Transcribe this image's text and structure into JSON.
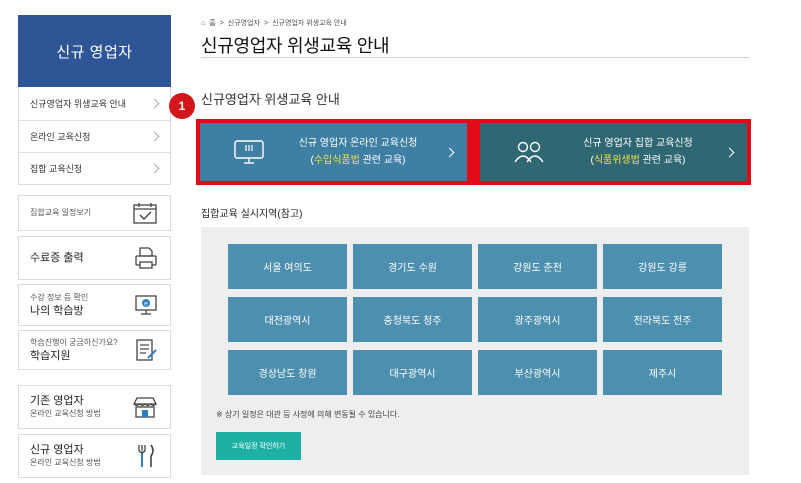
{
  "sidebar": {
    "title": "신규 영업자",
    "menu": [
      {
        "label": "신규영업자 위생교육 안내"
      },
      {
        "label": "온라인 교육신청"
      },
      {
        "label": "집합 교육신청"
      }
    ],
    "boxes": [
      {
        "small": "집합교육 일정보기",
        "big": "",
        "icon": "calendar-check-icon"
      },
      {
        "small": "",
        "big": "수료증 출력",
        "icon": "printer-icon"
      },
      {
        "small": "수강 정보 등 확인",
        "big": "나의 학습방",
        "icon": "monitor-e-icon"
      },
      {
        "small": "학습진행이 궁금하신가요?",
        "big": "학습지원",
        "icon": "document-pen-icon"
      },
      {
        "small": "온라인 교육신청 방법",
        "big": "기존 영업자",
        "icon": "store-icon"
      },
      {
        "small": "온라인 교육신청 방법",
        "big": "신규 영업자",
        "icon": "fork-knife-icon"
      }
    ]
  },
  "breadcrumb": {
    "home_label": "홈",
    "items": [
      "신규영업자",
      "신규영업자 위생교육 안내"
    ]
  },
  "page_title": "신규영업자 위생교육 안내",
  "section_title": "신규영업자 위생교육 안내",
  "step_badge": "1",
  "cta": {
    "online": {
      "line1": "신규 영업자 온라인 교육신청",
      "highlight": "수입식품법",
      "suffix": " 관련 교육)",
      "prefix": "(",
      "icon": "monitor-icon"
    },
    "group": {
      "line1": "신규 영업자 집합 교육신청",
      "highlight": "식품위생법",
      "suffix": " 관련 교육)",
      "prefix": "(",
      "icon": "people-icon"
    }
  },
  "regions": {
    "title": "집합교육 실시지역(참고)",
    "items": [
      "서울 여의도",
      "경기도 수원",
      "강원도 춘천",
      "강원도 강릉",
      "대전광역시",
      "충청북도 청주",
      "광주광역시",
      "전라북도 전주",
      "경상남도 창원",
      "대구광역시",
      "부산광역시",
      "제주시"
    ],
    "note": "※ 상기 일정은 대관 등 사정에 의해 변동될 수 있습니다.",
    "check_button": "교육일정 확인하기"
  },
  "colors": {
    "sidebar_header": "#2e5596",
    "cta_online": "#3e7fa3",
    "cta_group": "#2f6772",
    "highlight_border": "#e10a16",
    "region_button": "#4d8fae",
    "check_button": "#1eb0a4",
    "cta_highlight_text": "#f1e14a"
  }
}
